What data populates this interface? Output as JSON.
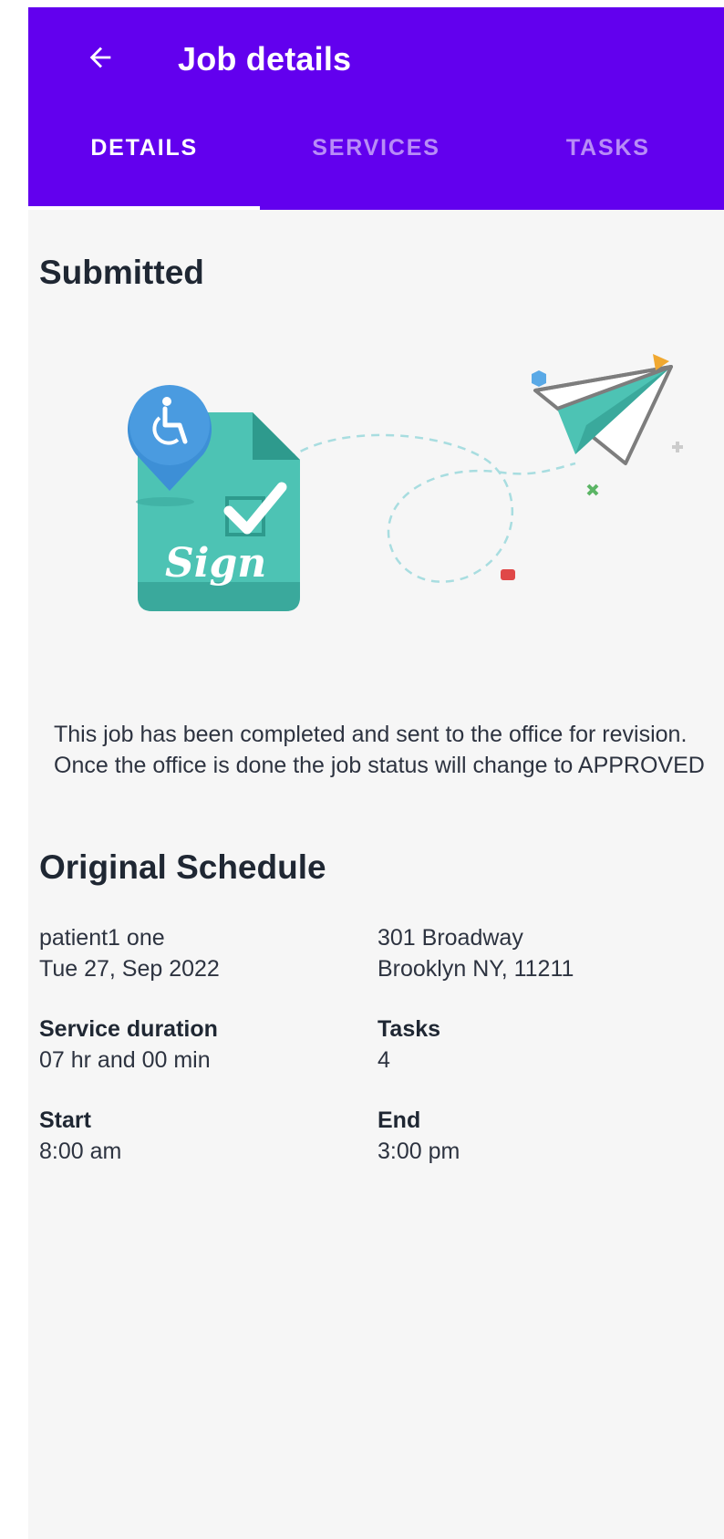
{
  "appbar": {
    "title": "Job details",
    "back_icon": "arrow-left-icon",
    "background": "#6200ee"
  },
  "tabs": [
    {
      "label": "DETAILS",
      "active": true
    },
    {
      "label": "SERVICES",
      "active": false
    },
    {
      "label": "TASKS",
      "active": false
    }
  ],
  "status": {
    "title": "Submitted",
    "illustration_text": "Sign",
    "description": "This job has been completed and sent to the office for revision. Once the office is done the job status will change to APPROVED"
  },
  "schedule": {
    "title": "Original Schedule",
    "patient": "patient1 one",
    "date": "Tue 27, Sep 2022",
    "address_line1": "301 Broadway",
    "address_line2": "Brooklyn NY, 11211",
    "service_duration_label": "Service duration",
    "service_duration": "07 hr and 00 min",
    "tasks_label": "Tasks",
    "tasks": "4",
    "start_label": "Start",
    "start": "8:00 am",
    "end_label": "End",
    "end": "3:00 pm"
  }
}
